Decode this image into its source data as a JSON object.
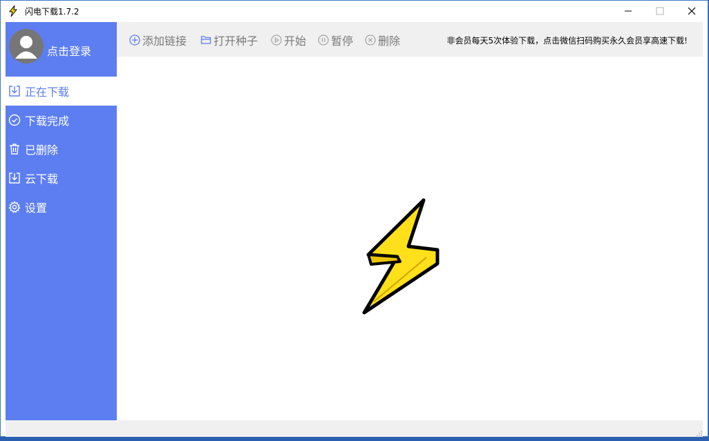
{
  "window": {
    "title": "闪电下载1.7.2"
  },
  "sidebar": {
    "login_label": "点击登录",
    "items": [
      {
        "label": "正在下载",
        "icon": "download-icon",
        "active": true
      },
      {
        "label": "下载完成",
        "icon": "check-circle-icon",
        "active": false
      },
      {
        "label": "已删除",
        "icon": "trash-icon",
        "active": false
      },
      {
        "label": "云下载",
        "icon": "cloud-download-icon",
        "active": false
      },
      {
        "label": "设置",
        "icon": "gear-icon",
        "active": false
      }
    ]
  },
  "toolbar": {
    "add_link": "添加链接",
    "open_torrent": "打开种子",
    "start": "开始",
    "pause": "暂停",
    "delete": "删除",
    "promo": "非会员每天5次体验下载，点击微信扫码购买永久会员享高速下载!"
  },
  "colors": {
    "sidebar": "#5c7ef1",
    "accent": "#5c7ef1",
    "bolt": "#ffe01a"
  }
}
